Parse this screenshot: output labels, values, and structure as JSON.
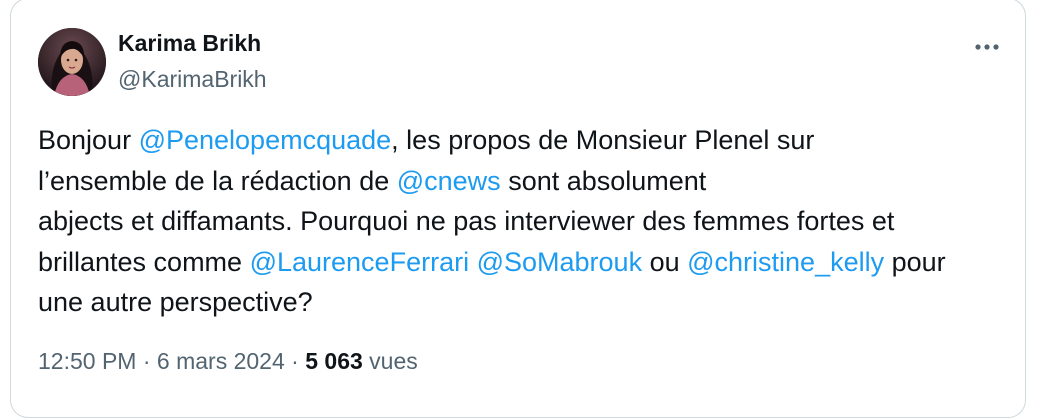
{
  "author": {
    "name": "Karima Brikh",
    "handle": "@KarimaBrikh",
    "avatar": "profile-photo"
  },
  "menu": {
    "icon": "more-icon",
    "label": "···"
  },
  "tweet": {
    "lines": [
      [
        {
          "type": "text",
          "value": "Bonjour "
        },
        {
          "type": "mention",
          "value": "@Penelopemcquade"
        },
        {
          "type": "text",
          "value": ", les propos de Monsieur Plenel sur"
        }
      ],
      [
        {
          "type": "text",
          "value": "l’ensemble de la rédaction de "
        },
        {
          "type": "mention",
          "value": "@cnews"
        },
        {
          "type": "text",
          "value": " sont absolument"
        }
      ],
      [
        {
          "type": "text",
          "value": "abjects et diffamants. Pourquoi ne pas interviewer des femmes fortes et"
        }
      ],
      [
        {
          "type": "text",
          "value": "brillantes comme "
        },
        {
          "type": "mention",
          "value": "@LaurenceFerrari"
        },
        {
          "type": "text",
          "value": " "
        },
        {
          "type": "mention",
          "value": "@SoMabrouk"
        },
        {
          "type": "text",
          "value": " ou "
        },
        {
          "type": "mention",
          "value": "@christine_kelly"
        },
        {
          "type": "text",
          "value": " pour"
        }
      ],
      [
        {
          "type": "text",
          "value": "une autre perspective?"
        }
      ]
    ]
  },
  "meta": {
    "time": "12:50 PM",
    "separator": " · ",
    "date": "6 mars 2024",
    "views_count": "5 063",
    "views_label": "vues"
  },
  "colors": {
    "mention": "#1d9bf0",
    "secondary": "#536471",
    "text": "#0f1419",
    "border": "#cfd9de"
  }
}
